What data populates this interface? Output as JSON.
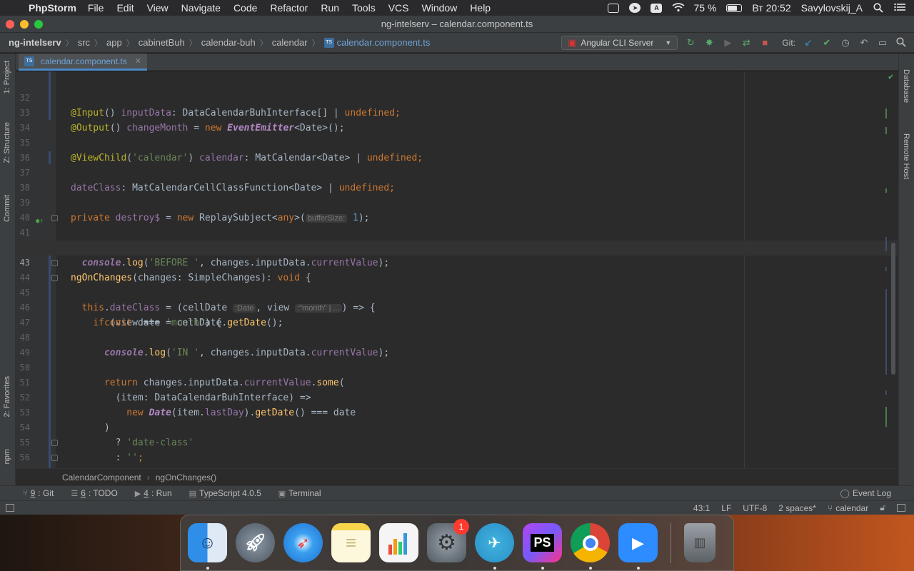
{
  "menubar": {
    "app_name": "PhpStorm",
    "menus": [
      "File",
      "Edit",
      "View",
      "Navigate",
      "Code",
      "Refactor",
      "Run",
      "Tools",
      "VCS",
      "Window",
      "Help"
    ],
    "battery_text": "75 %",
    "battery_level": 0.75,
    "clock": "Вт 20:52",
    "user": "Savylovskij_A",
    "input_source": "A"
  },
  "window": {
    "title": "ng-intelserv – calendar.component.ts"
  },
  "navbar": {
    "crumbs": [
      "ng-intelserv",
      "src",
      "app",
      "cabinetBuh",
      "calendar-buh",
      "calendar",
      "calendar.component.ts"
    ],
    "run_config": "Angular CLI Server",
    "git_label": "Git:"
  },
  "tab": {
    "label": "calendar.component.ts",
    "file_badge": "TS"
  },
  "side_tabs": {
    "project": "1: Project",
    "structure": "Z: Structure",
    "commit": "Commit",
    "favorites": "2: Favorites",
    "npm": "npm",
    "database": "Database",
    "remote_host": "Remote Host"
  },
  "editor": {
    "line_numbers": [
      "32",
      "33",
      "34",
      "35",
      "36",
      "37",
      "38",
      "39",
      "40",
      "41",
      "42",
      "43",
      "44",
      "45",
      "46",
      "47",
      "48",
      "49",
      "50",
      "51",
      "52",
      "53",
      "54",
      "55",
      "56",
      "57"
    ],
    "current_line": "43",
    "hints": {
      "buffer_size": "bufferSize:",
      "date_type": ":Date",
      "view_type": ":\"month\" | ..."
    }
  },
  "editor_breadcrumb": [
    "CalendarComponent",
    "ngOnChanges()"
  ],
  "tool_windows": {
    "git": {
      "num": "9",
      "label": ": Git"
    },
    "todo": {
      "num": "6",
      "label": ": TODO"
    },
    "run": {
      "num": "4",
      "label": ": Run"
    },
    "typescript": "TypeScript 4.0.5",
    "terminal": "Terminal",
    "event_log": "Event Log"
  },
  "statusbar": {
    "position": "43:1",
    "line_sep": "LF",
    "encoding": "UTF-8",
    "indent": "2 spaces*",
    "branch": "calendar"
  },
  "dock": {
    "apps": [
      "finder-icon",
      "launchpad-icon",
      "safari-icon",
      "notes-icon",
      "numbers-icon",
      "system-preferences-icon",
      "telegram-icon",
      "phpstorm-icon",
      "chrome-icon",
      "zoom-icon",
      "trash-icon"
    ],
    "ps_label": "PS",
    "badge_count": "1"
  },
  "colors": {
    "editor_bg": "#2b2b2b",
    "keyword": "#cc7832",
    "annotation": "#bbb529",
    "string": "#6a8759",
    "field": "#9876aa",
    "function": "#ffc66d",
    "number": "#6897bb"
  }
}
